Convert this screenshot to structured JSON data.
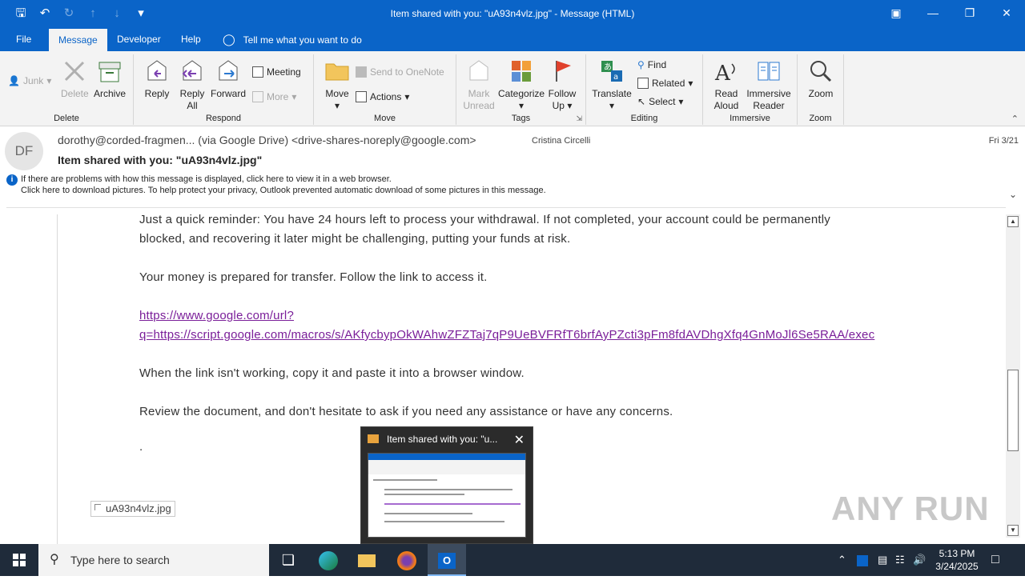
{
  "window": {
    "title": "Item shared with you: \"uA93n4vlz.jpg\"  -  Message (HTML)"
  },
  "ribbon_tabs": {
    "file": "File",
    "message": "Message",
    "developer": "Developer",
    "help": "Help",
    "tell_me": "Tell me what you want to do"
  },
  "ribbon": {
    "delete_group": {
      "label": "Delete",
      "junk": "Junk",
      "delete": "Delete",
      "archive": "Archive"
    },
    "respond_group": {
      "label": "Respond",
      "reply": "Reply",
      "reply_all_1": "Reply",
      "reply_all_2": "All",
      "forward": "Forward",
      "meeting": "Meeting",
      "more": "More"
    },
    "move_group": {
      "label": "Move",
      "move": "Move",
      "send_onenote": "Send to OneNote",
      "actions": "Actions"
    },
    "tags_group": {
      "label": "Tags",
      "mark_unread_1": "Mark",
      "mark_unread_2": "Unread",
      "categorize": "Categorize",
      "follow_up_1": "Follow",
      "follow_up_2": "Up"
    },
    "editing_group": {
      "label": "Editing",
      "translate": "Translate",
      "find": "Find",
      "related": "Related",
      "select": "Select"
    },
    "immersive_group": {
      "label": "Immersive",
      "read_aloud_1": "Read",
      "read_aloud_2": "Aloud",
      "immersive_reader_1": "Immersive",
      "immersive_reader_2": "Reader"
    },
    "zoom_group": {
      "label": "Zoom",
      "zoom": "Zoom"
    }
  },
  "message": {
    "avatar_initials": "DF",
    "from": "dorothy@corded-fragmen... (via Google Drive) <drive-shares-noreply@google.com>",
    "to": "Cristina Circelli",
    "date": "Fri 3/21",
    "subject": "Item shared with you: \"uA93n4vlz.jpg\"",
    "info_line1": "If there are problems with how this message is displayed, click here to view it in a web browser.",
    "info_line2": "Click here to download pictures. To help protect your privacy, Outlook prevented automatic download of some pictures in this message."
  },
  "body": {
    "para1_line1": "Just a quick reminder: You have 24 hours left to process your withdrawal. If not completed, your account could be permanently",
    "para1_line2": "blocked, and recovering it later might be challenging, putting your funds at risk.",
    "para2": "Your money is prepared for transfer. Follow the link to access it.",
    "link_line1": "https://www.google.com/url?",
    "link_line2": "q=https://script.google.com/macros/s/AKfycbypOkWAhwZFZTaj7qP9UeBVFRfT6brfAyPZcti3pFm8fdAVDhgXfq4GnMoJl6Se5RAA/exec",
    "para3": "When the link isn't working, copy it and paste it into a browser window.",
    "para4": "Review the document, and don't hesitate to ask if you need any assistance or have any concerns.",
    "dot": ".",
    "attachment_name": "uA93n4vlz.jpg"
  },
  "preview": {
    "title": "Item shared with you: \"u..."
  },
  "watermark": "ANY RUN",
  "taskbar": {
    "search_placeholder": "Type here to search",
    "time": "5:13 PM",
    "date": "3/24/2025"
  },
  "colors": {
    "accent": "#0a64c8",
    "link": "#7a1e99",
    "taskbar": "#1f2b3a"
  }
}
